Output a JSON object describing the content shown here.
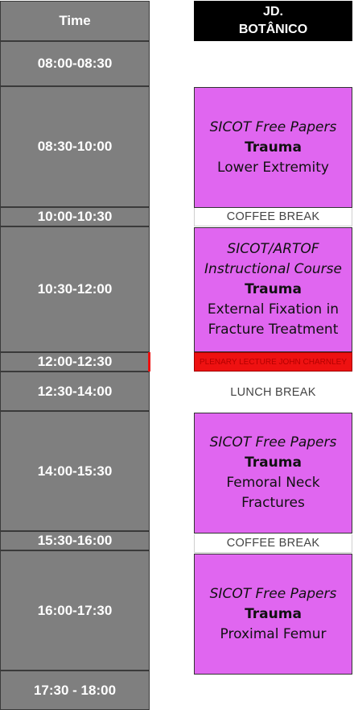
{
  "header": {
    "time_label": "Time",
    "venue_line1": "JD.",
    "venue_line2": "BOTÂNICO"
  },
  "times": [
    "08:00-08:30",
    "08:30-10:00",
    "10:00-10:30",
    "10:30-12:00",
    "12:00-12:30",
    "12:30-14:00",
    "14:00-15:30",
    "15:30-16:00",
    "16:00-17:30",
    "17:30 - 18:00"
  ],
  "sessions": [
    {
      "series": "SICOT Free Papers",
      "track": "Trauma",
      "topic": "Lower Extremity"
    },
    {
      "series_line1": "SICOT/ARTOF",
      "series_line2": "Instructional Course",
      "track": "Trauma",
      "topic_line1": "External Fixation in",
      "topic_line2": "Fracture Treatment"
    },
    {
      "series": "SICOT Free Papers",
      "track": "Trauma",
      "topic": "Femoral Neck Fractures"
    },
    {
      "series": "SICOT Free Papers",
      "track": "Trauma",
      "topic": "Proximal Femur"
    }
  ],
  "breaks": {
    "coffee_1": "COFFEE BREAK",
    "lunch": "LUNCH BREAK",
    "coffee_2": "COFFEE BREAK",
    "plenary": "PLENARY LECTURE JOHN CHARNLEY"
  },
  "colors": {
    "time_bg": "#7f7f7f",
    "session_bg": "#e066f0",
    "plenary_bg": "#ee1111",
    "header_bg": "#000000"
  }
}
